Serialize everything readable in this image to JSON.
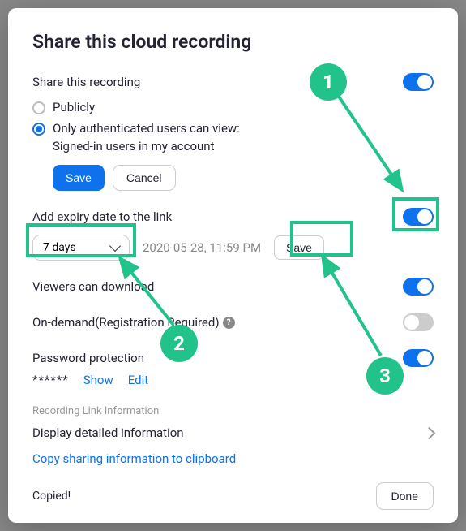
{
  "modal": {
    "title": "Share this cloud recording",
    "shareLabel": "Share this recording",
    "radioPublic": "Publicly",
    "radioAuth": "Only authenticated users can view:",
    "radioAuthSub": "Signed-in users in my account",
    "save": "Save",
    "cancel": "Cancel",
    "expiryLabel": "Add expiry date to the link",
    "expirySelect": "7 days",
    "expiryDate": "2020-05-28, 11:59 PM",
    "expirySave": "Save",
    "viewersDownload": "Viewers can download",
    "onDemand": "On-demand(Registration Required)",
    "passwordProtection": "Password protection",
    "passwordMask": "******",
    "show": "Show",
    "edit": "Edit",
    "recordingLinkInfo": "Recording Link Information",
    "displayDetail": "Display detailed information",
    "copyInfo": "Copy sharing information to clipboard",
    "copied": "Copied!",
    "done": "Done"
  },
  "annotations": {
    "b1": "1",
    "b2": "2",
    "b3": "3"
  }
}
